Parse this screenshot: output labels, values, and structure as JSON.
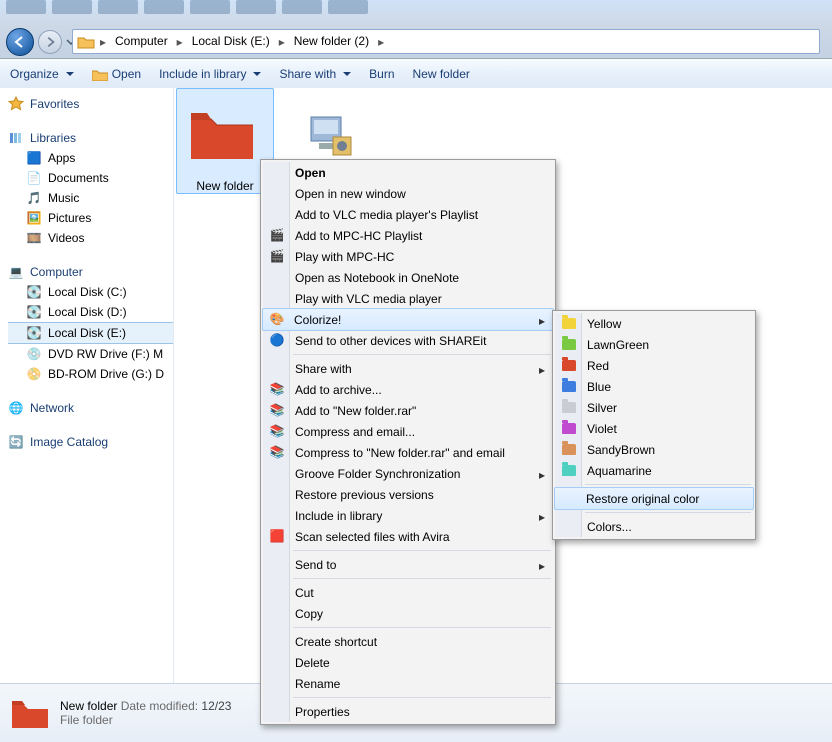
{
  "breadcrumbs": [
    "Computer",
    "Local Disk (E:)",
    "New folder (2)"
  ],
  "toolbar": {
    "organize": "Organize",
    "open": "Open",
    "include": "Include in library",
    "share": "Share with",
    "burn": "Burn",
    "newfolder": "New folder"
  },
  "sidebar": {
    "favorites": "Favorites",
    "libraries": "Libraries",
    "lib_items": [
      "Apps",
      "Documents",
      "Music",
      "Pictures",
      "Videos"
    ],
    "computer": "Computer",
    "drives": [
      "Local Disk (C:)",
      "Local Disk (D:)",
      "Local Disk (E:)",
      "DVD RW Drive (F:)  M",
      "BD-ROM Drive (G:) D"
    ],
    "network": "Network",
    "imagecat": "Image Catalog"
  },
  "files": {
    "item1": "New folder"
  },
  "details": {
    "name": "New folder",
    "modlabel": "Date modified:",
    "modval": "12/23",
    "type": "File folder"
  },
  "ctx": {
    "open": "Open",
    "openwin": "Open in new window",
    "vlcadd": "Add to VLC media player's Playlist",
    "mpcadd": "Add to MPC-HC Playlist",
    "mpcplay": "Play with MPC-HC",
    "onenote": "Open as Notebook in OneNote",
    "vlcplay": "Play with VLC media player",
    "colorize": "Colorize!",
    "shareit": "Send to other devices with SHAREit",
    "sharewith": "Share with",
    "addarch": "Add to archive...",
    "addrar": "Add to \"New folder.rar\"",
    "comemail": "Compress and email...",
    "compemail": "Compress to \"New folder.rar\" and email",
    "groove": "Groove Folder Synchronization",
    "restore": "Restore previous versions",
    "inclib": "Include in library",
    "avira": "Scan selected files with Avira",
    "sendto": "Send to",
    "cut": "Cut",
    "copy": "Copy",
    "shortcut": "Create shortcut",
    "delete": "Delete",
    "rename": "Rename",
    "props": "Properties"
  },
  "submenu": {
    "colors": [
      {
        "name": "Yellow",
        "hex": "#f2d33a"
      },
      {
        "name": "LawnGreen",
        "hex": "#7ac943"
      },
      {
        "name": "Red",
        "hex": "#d9482b"
      },
      {
        "name": "Blue",
        "hex": "#3d7de0"
      },
      {
        "name": "Silver",
        "hex": "#c9ccd0"
      },
      {
        "name": "Violet",
        "hex": "#c14bcf"
      },
      {
        "name": "SandyBrown",
        "hex": "#d9925a"
      },
      {
        "name": "Aquamarine",
        "hex": "#4fd0c0"
      }
    ],
    "restore": "Restore original color",
    "more": "Colors..."
  }
}
